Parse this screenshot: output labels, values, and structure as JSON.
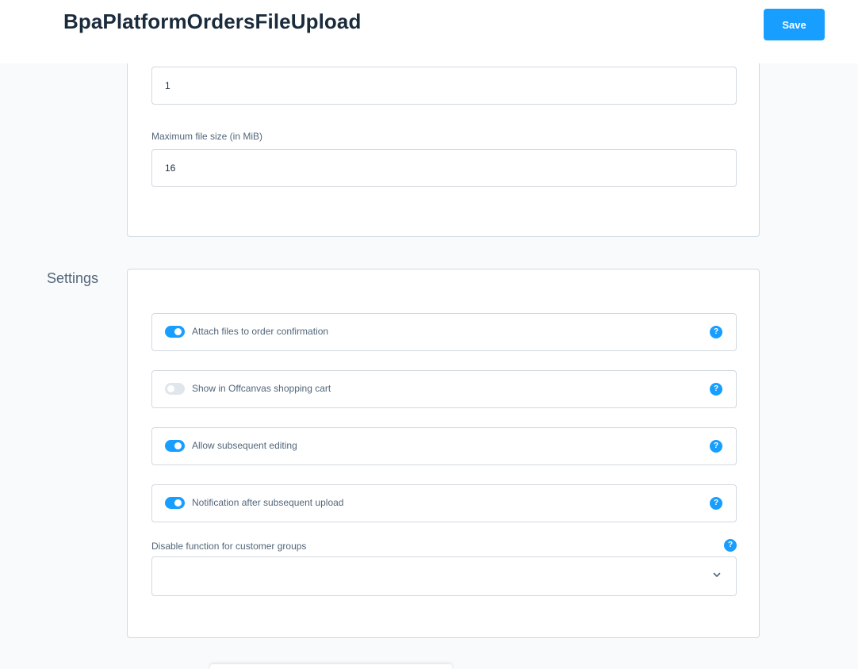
{
  "header": {
    "title": "BpaPlatformOrdersFileUpload",
    "save_label": "Save"
  },
  "upload_limits": {
    "first_field": {
      "value": "1"
    },
    "max_file_size": {
      "label": "Maximum file size (in MiB)",
      "value": "16"
    }
  },
  "settings": {
    "title": "Settings",
    "switches": [
      {
        "label": "Attach files to order confirmation",
        "on": true
      },
      {
        "label": "Show in Offcanvas shopping cart",
        "on": false
      },
      {
        "label": "Allow subsequent editing",
        "on": true
      },
      {
        "label": "Notification after subsequent upload",
        "on": true
      }
    ],
    "customer_groups": {
      "label": "Disable function for customer groups",
      "value": ""
    }
  },
  "icons": {
    "help": "help-icon",
    "dropdown": "chevron-down-icon"
  },
  "colors": {
    "accent": "#189eff",
    "border": "#d1d9e0",
    "heading": "#1a2b3c",
    "text": "#52667a",
    "background": "#f9fafb",
    "toggle_off": "#e0e6eb"
  },
  "help_glyph": "?"
}
